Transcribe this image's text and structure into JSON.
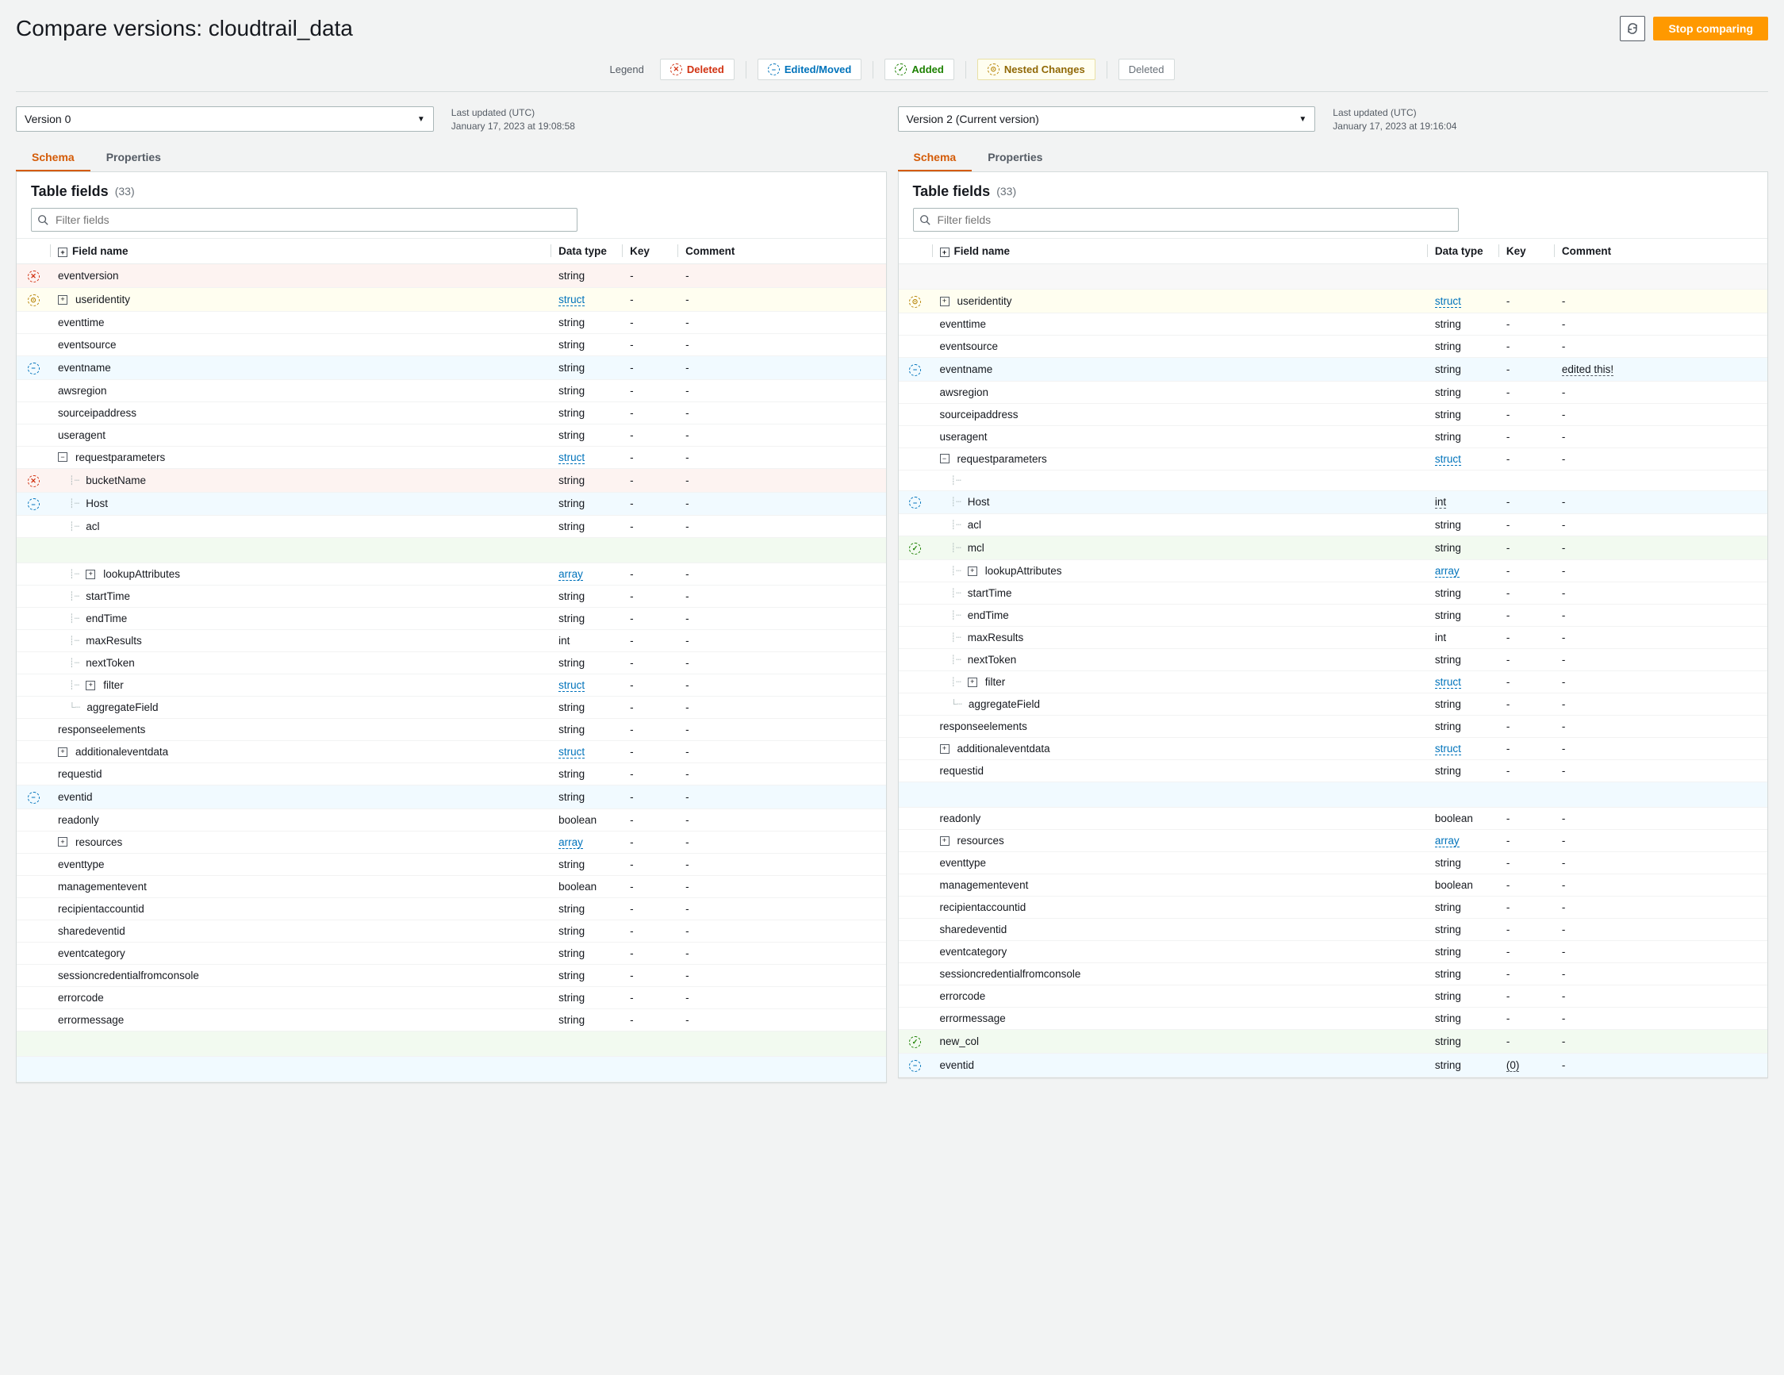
{
  "title": "Compare versions: cloudtrail_data",
  "stop_btn": "Stop comparing",
  "legend": {
    "label": "Legend",
    "deleted": "Deleted",
    "edited": "Edited/Moved",
    "added": "Added",
    "nested": "Nested Changes",
    "deleted_plain": "Deleted"
  },
  "left": {
    "version": "Version 0",
    "meta_label": "Last updated (UTC)",
    "meta_time": "January 17, 2023 at 19:08:58"
  },
  "right": {
    "version": "Version 2 (Current version)",
    "meta_label": "Last updated (UTC)",
    "meta_time": "January 17, 2023 at 19:16:04"
  },
  "tabs": {
    "schema": "Schema",
    "properties": "Properties"
  },
  "panel": {
    "title": "Table fields",
    "count": "(33)",
    "filter_ph": "Filter fields"
  },
  "cols": {
    "name": "Field name",
    "type": "Data type",
    "key": "Key",
    "comment": "Comment"
  },
  "rows_left": [
    {
      "status": "deleted",
      "indent": 0,
      "exp": "",
      "tree": "",
      "name": "eventversion",
      "type": "string",
      "key": "-",
      "comment": "-"
    },
    {
      "status": "nested",
      "indent": 0,
      "exp": "+",
      "tree": "",
      "name": "useridentity",
      "type": "struct",
      "link": true,
      "key": "-",
      "comment": "-"
    },
    {
      "status": "",
      "indent": 0,
      "exp": "",
      "tree": "",
      "name": "eventtime",
      "type": "string",
      "key": "-",
      "comment": "-"
    },
    {
      "status": "",
      "indent": 0,
      "exp": "",
      "tree": "",
      "name": "eventsource",
      "type": "string",
      "key": "-",
      "comment": "-"
    },
    {
      "status": "edited",
      "indent": 0,
      "exp": "",
      "tree": "",
      "name": "eventname",
      "type": "string",
      "key": "-",
      "comment": "-"
    },
    {
      "status": "",
      "indent": 0,
      "exp": "",
      "tree": "",
      "name": "awsregion",
      "type": "string",
      "key": "-",
      "comment": "-"
    },
    {
      "status": "",
      "indent": 0,
      "exp": "",
      "tree": "",
      "name": "sourceipaddress",
      "type": "string",
      "key": "-",
      "comment": "-"
    },
    {
      "status": "",
      "indent": 0,
      "exp": "",
      "tree": "",
      "name": "useragent",
      "type": "string",
      "key": "-",
      "comment": "-"
    },
    {
      "status": "",
      "indent": 0,
      "exp": "-",
      "tree": "",
      "name": "requestparameters",
      "type": "struct",
      "link": true,
      "key": "-",
      "comment": "-"
    },
    {
      "status": "deleted",
      "indent": 1,
      "exp": "",
      "tree": "┊┄",
      "name": "bucketName",
      "type": "string",
      "key": "-",
      "comment": "-"
    },
    {
      "status": "edited",
      "indent": 1,
      "exp": "",
      "tree": "┊┄",
      "name": "Host",
      "type": "string",
      "key": "-",
      "comment": "-"
    },
    {
      "status": "",
      "indent": 1,
      "exp": "",
      "tree": "┊┄",
      "name": "acl",
      "type": "string",
      "key": "-",
      "comment": "-"
    },
    {
      "status": "placeholder-added"
    },
    {
      "status": "",
      "indent": 1,
      "exp": "+",
      "tree": "┊┄",
      "name": "lookupAttributes",
      "type": "array",
      "link": true,
      "key": "-",
      "comment": "-"
    },
    {
      "status": "",
      "indent": 1,
      "exp": "",
      "tree": "┊┄",
      "name": "startTime",
      "type": "string",
      "key": "-",
      "comment": "-"
    },
    {
      "status": "",
      "indent": 1,
      "exp": "",
      "tree": "┊┄",
      "name": "endTime",
      "type": "string",
      "key": "-",
      "comment": "-"
    },
    {
      "status": "",
      "indent": 1,
      "exp": "",
      "tree": "┊┄",
      "name": "maxResults",
      "type": "int",
      "key": "-",
      "comment": "-"
    },
    {
      "status": "",
      "indent": 1,
      "exp": "",
      "tree": "┊┄",
      "name": "nextToken",
      "type": "string",
      "key": "-",
      "comment": "-"
    },
    {
      "status": "",
      "indent": 1,
      "exp": "+",
      "tree": "┊┄",
      "name": "filter",
      "type": "struct",
      "link": true,
      "key": "-",
      "comment": "-"
    },
    {
      "status": "",
      "indent": 1,
      "exp": "",
      "tree": "└┄",
      "name": "aggregateField",
      "type": "string",
      "key": "-",
      "comment": "-"
    },
    {
      "status": "",
      "indent": 0,
      "exp": "",
      "tree": "",
      "name": "responseelements",
      "type": "string",
      "key": "-",
      "comment": "-"
    },
    {
      "status": "",
      "indent": 0,
      "exp": "+",
      "tree": "",
      "name": "additionaleventdata",
      "type": "struct",
      "link": true,
      "key": "-",
      "comment": "-"
    },
    {
      "status": "",
      "indent": 0,
      "exp": "",
      "tree": "",
      "name": "requestid",
      "type": "string",
      "key": "-",
      "comment": "-"
    },
    {
      "status": "edited",
      "indent": 0,
      "exp": "",
      "tree": "",
      "name": "eventid",
      "type": "string",
      "key": "-",
      "comment": "-"
    },
    {
      "status": "",
      "indent": 0,
      "exp": "",
      "tree": "",
      "name": "readonly",
      "type": "boolean",
      "key": "-",
      "comment": "-"
    },
    {
      "status": "",
      "indent": 0,
      "exp": "+",
      "tree": "",
      "name": "resources",
      "type": "array",
      "link": true,
      "key": "-",
      "comment": "-"
    },
    {
      "status": "",
      "indent": 0,
      "exp": "",
      "tree": "",
      "name": "eventtype",
      "type": "string",
      "key": "-",
      "comment": "-"
    },
    {
      "status": "",
      "indent": 0,
      "exp": "",
      "tree": "",
      "name": "managementevent",
      "type": "boolean",
      "key": "-",
      "comment": "-"
    },
    {
      "status": "",
      "indent": 0,
      "exp": "",
      "tree": "",
      "name": "recipientaccountid",
      "type": "string",
      "key": "-",
      "comment": "-"
    },
    {
      "status": "",
      "indent": 0,
      "exp": "",
      "tree": "",
      "name": "sharedeventid",
      "type": "string",
      "key": "-",
      "comment": "-"
    },
    {
      "status": "",
      "indent": 0,
      "exp": "",
      "tree": "",
      "name": "eventcategory",
      "type": "string",
      "key": "-",
      "comment": "-"
    },
    {
      "status": "",
      "indent": 0,
      "exp": "",
      "tree": "",
      "name": "sessioncredentialfromconsole",
      "type": "string",
      "key": "-",
      "comment": "-"
    },
    {
      "status": "",
      "indent": 0,
      "exp": "",
      "tree": "",
      "name": "errorcode",
      "type": "string",
      "key": "-",
      "comment": "-"
    },
    {
      "status": "",
      "indent": 0,
      "exp": "",
      "tree": "",
      "name": "errormessage",
      "type": "string",
      "key": "-",
      "comment": "-"
    },
    {
      "status": "placeholder-added"
    },
    {
      "status": "placeholder-edited"
    }
  ],
  "rows_right": [
    {
      "status": "placeholder"
    },
    {
      "status": "nested",
      "indent": 0,
      "exp": "+",
      "tree": "",
      "name": "useridentity",
      "type": "struct",
      "link": true,
      "key": "-",
      "comment": "-"
    },
    {
      "status": "",
      "indent": 0,
      "exp": "",
      "tree": "",
      "name": "eventtime",
      "type": "string",
      "key": "-",
      "comment": "-"
    },
    {
      "status": "",
      "indent": 0,
      "exp": "",
      "tree": "",
      "name": "eventsource",
      "type": "string",
      "key": "-",
      "comment": "-"
    },
    {
      "status": "edited",
      "indent": 0,
      "exp": "",
      "tree": "",
      "name": "eventname",
      "type": "string",
      "key": "-",
      "comment": "edited this!",
      "comment_under": true
    },
    {
      "status": "",
      "indent": 0,
      "exp": "",
      "tree": "",
      "name": "awsregion",
      "type": "string",
      "key": "-",
      "comment": "-"
    },
    {
      "status": "",
      "indent": 0,
      "exp": "",
      "tree": "",
      "name": "sourceipaddress",
      "type": "string",
      "key": "-",
      "comment": "-"
    },
    {
      "status": "",
      "indent": 0,
      "exp": "",
      "tree": "",
      "name": "useragent",
      "type": "string",
      "key": "-",
      "comment": "-"
    },
    {
      "status": "",
      "indent": 0,
      "exp": "-",
      "tree": "",
      "name": "requestparameters",
      "type": "struct",
      "link": true,
      "key": "-",
      "comment": "-"
    },
    {
      "status": "",
      "indent": 1,
      "exp": "",
      "tree": "┊┄",
      "name": "",
      "type": "",
      "key": "",
      "comment": ""
    },
    {
      "status": "edited",
      "indent": 1,
      "exp": "",
      "tree": "┊┄",
      "name": "Host",
      "type": "int",
      "type_under": true,
      "key": "-",
      "comment": "-"
    },
    {
      "status": "",
      "indent": 1,
      "exp": "",
      "tree": "┊┄",
      "name": "acl",
      "type": "string",
      "key": "-",
      "comment": "-"
    },
    {
      "status": "added",
      "indent": 1,
      "exp": "",
      "tree": "┊┄",
      "name": "mcl",
      "type": "string",
      "key": "-",
      "comment": "-"
    },
    {
      "status": "",
      "indent": 1,
      "exp": "+",
      "tree": "┊┄",
      "name": "lookupAttributes",
      "type": "array",
      "link": true,
      "key": "-",
      "comment": "-"
    },
    {
      "status": "",
      "indent": 1,
      "exp": "",
      "tree": "┊┄",
      "name": "startTime",
      "type": "string",
      "key": "-",
      "comment": "-"
    },
    {
      "status": "",
      "indent": 1,
      "exp": "",
      "tree": "┊┄",
      "name": "endTime",
      "type": "string",
      "key": "-",
      "comment": "-"
    },
    {
      "status": "",
      "indent": 1,
      "exp": "",
      "tree": "┊┄",
      "name": "maxResults",
      "type": "int",
      "key": "-",
      "comment": "-"
    },
    {
      "status": "",
      "indent": 1,
      "exp": "",
      "tree": "┊┄",
      "name": "nextToken",
      "type": "string",
      "key": "-",
      "comment": "-"
    },
    {
      "status": "",
      "indent": 1,
      "exp": "+",
      "tree": "┊┄",
      "name": "filter",
      "type": "struct",
      "link": true,
      "key": "-",
      "comment": "-"
    },
    {
      "status": "",
      "indent": 1,
      "exp": "",
      "tree": "└┄",
      "name": "aggregateField",
      "type": "string",
      "key": "-",
      "comment": "-"
    },
    {
      "status": "",
      "indent": 0,
      "exp": "",
      "tree": "",
      "name": "responseelements",
      "type": "string",
      "key": "-",
      "comment": "-"
    },
    {
      "status": "",
      "indent": 0,
      "exp": "+",
      "tree": "",
      "name": "additionaleventdata",
      "type": "struct",
      "link": true,
      "key": "-",
      "comment": "-"
    },
    {
      "status": "",
      "indent": 0,
      "exp": "",
      "tree": "",
      "name": "requestid",
      "type": "string",
      "key": "-",
      "comment": "-"
    },
    {
      "status": "placeholder-edited"
    },
    {
      "status": "",
      "indent": 0,
      "exp": "",
      "tree": "",
      "name": "readonly",
      "type": "boolean",
      "key": "-",
      "comment": "-"
    },
    {
      "status": "",
      "indent": 0,
      "exp": "+",
      "tree": "",
      "name": "resources",
      "type": "array",
      "link": true,
      "key": "-",
      "comment": "-"
    },
    {
      "status": "",
      "indent": 0,
      "exp": "",
      "tree": "",
      "name": "eventtype",
      "type": "string",
      "key": "-",
      "comment": "-"
    },
    {
      "status": "",
      "indent": 0,
      "exp": "",
      "tree": "",
      "name": "managementevent",
      "type": "boolean",
      "key": "-",
      "comment": "-"
    },
    {
      "status": "",
      "indent": 0,
      "exp": "",
      "tree": "",
      "name": "recipientaccountid",
      "type": "string",
      "key": "-",
      "comment": "-"
    },
    {
      "status": "",
      "indent": 0,
      "exp": "",
      "tree": "",
      "name": "sharedeventid",
      "type": "string",
      "key": "-",
      "comment": "-"
    },
    {
      "status": "",
      "indent": 0,
      "exp": "",
      "tree": "",
      "name": "eventcategory",
      "type": "string",
      "key": "-",
      "comment": "-"
    },
    {
      "status": "",
      "indent": 0,
      "exp": "",
      "tree": "",
      "name": "sessioncredentialfromconsole",
      "type": "string",
      "key": "-",
      "comment": "-"
    },
    {
      "status": "",
      "indent": 0,
      "exp": "",
      "tree": "",
      "name": "errorcode",
      "type": "string",
      "key": "-",
      "comment": "-"
    },
    {
      "status": "",
      "indent": 0,
      "exp": "",
      "tree": "",
      "name": "errormessage",
      "type": "string",
      "key": "-",
      "comment": "-"
    },
    {
      "status": "added",
      "indent": 0,
      "exp": "",
      "tree": "",
      "name": "new_col",
      "type": "string",
      "key": "-",
      "comment": "-"
    },
    {
      "status": "edited",
      "indent": 0,
      "exp": "",
      "tree": "",
      "name": "eventid",
      "type": "string",
      "key": "(0)",
      "key_under": true,
      "comment": "-"
    }
  ]
}
